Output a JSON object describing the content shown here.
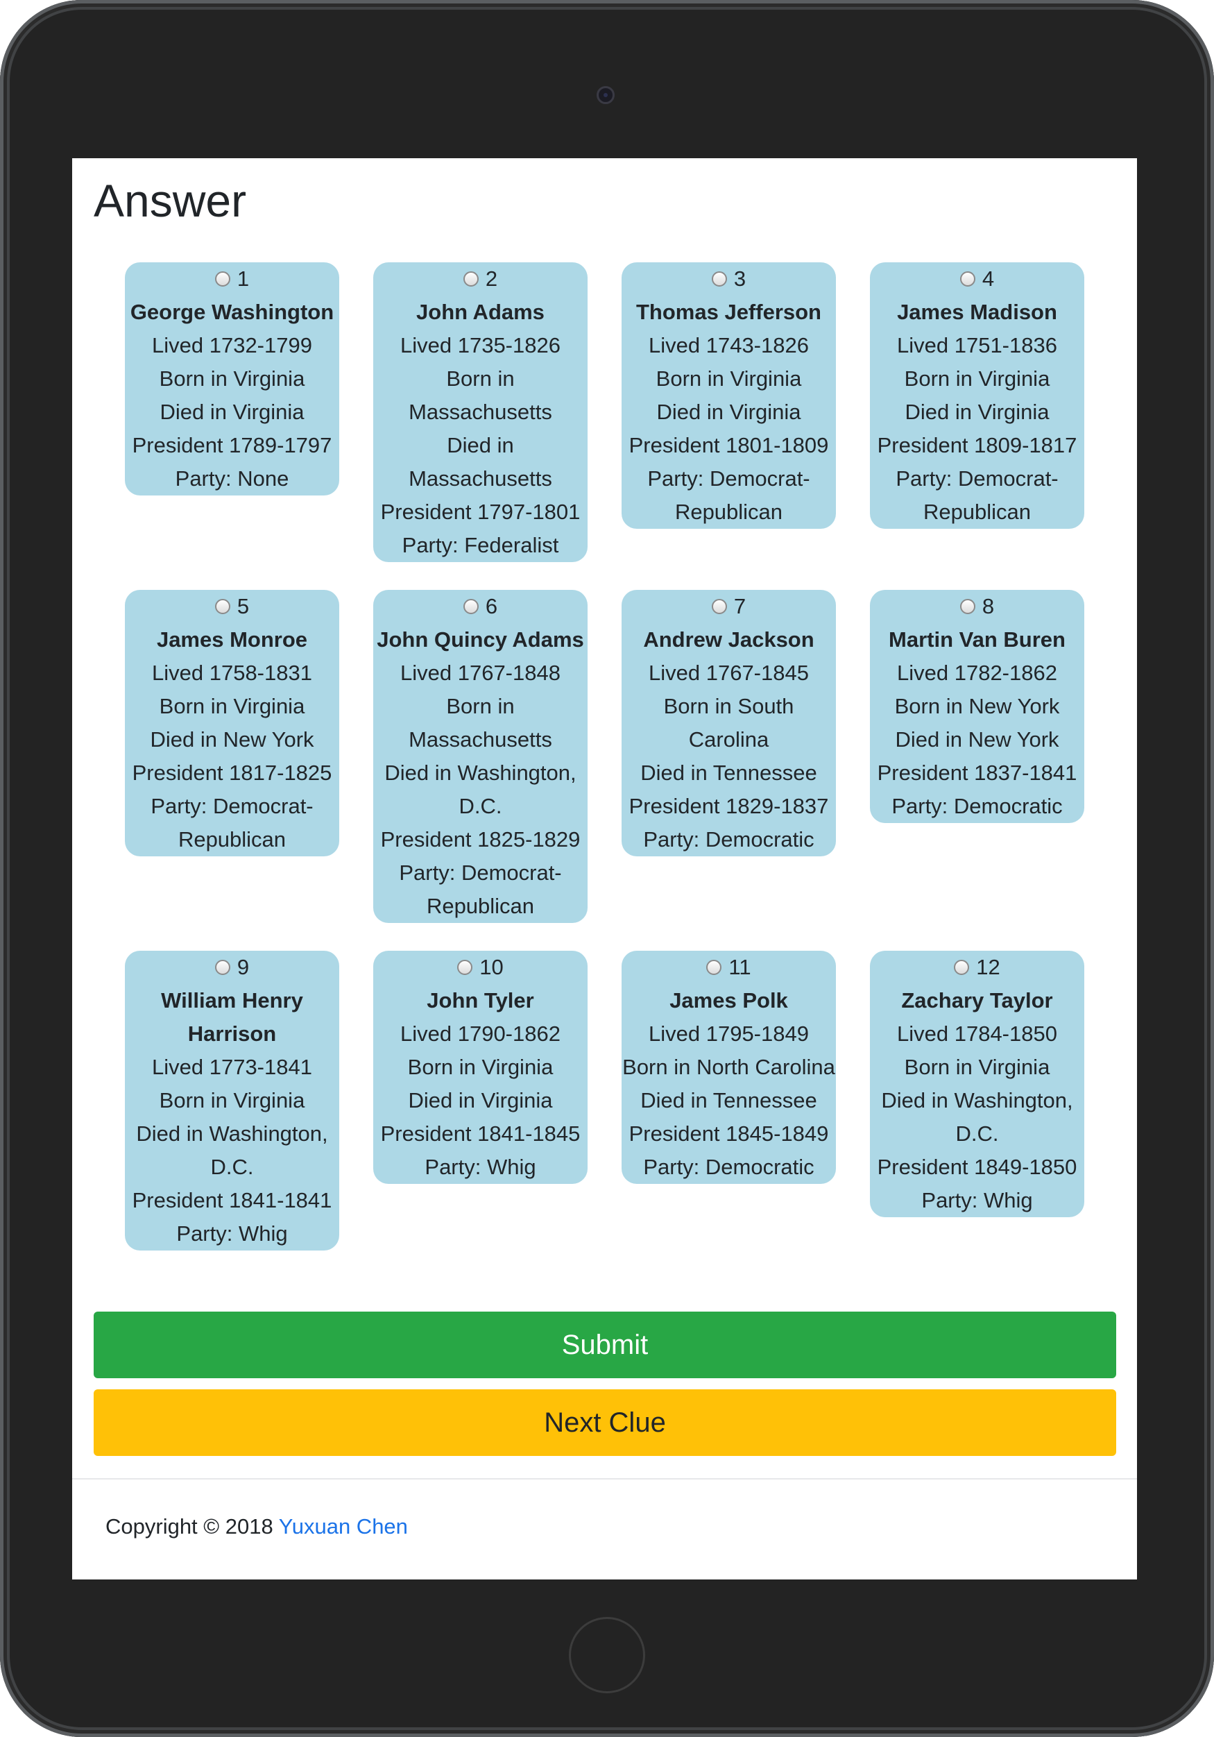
{
  "page": {
    "title": "Answer"
  },
  "presidents": [
    {
      "number": "1",
      "name": "George Washington",
      "lived": "Lived 1732-1799",
      "born": "Born in Virginia",
      "died": "Died in Virginia",
      "president": "President 1789-1797",
      "party": "Party: None"
    },
    {
      "number": "2",
      "name": "John Adams",
      "lived": "Lived 1735-1826",
      "born": "Born in Massachusetts",
      "died": "Died in Massachusetts",
      "president": "President 1797-1801",
      "party": "Party: Federalist"
    },
    {
      "number": "3",
      "name": "Thomas Jefferson",
      "lived": "Lived 1743-1826",
      "born": "Born in Virginia",
      "died": "Died in Virginia",
      "president": "President 1801-1809",
      "party": "Party: Democrat-Republican"
    },
    {
      "number": "4",
      "name": "James Madison",
      "lived": "Lived 1751-1836",
      "born": "Born in Virginia",
      "died": "Died in Virginia",
      "president": "President 1809-1817",
      "party": "Party: Democrat-Republican"
    },
    {
      "number": "5",
      "name": "James Monroe",
      "lived": "Lived 1758-1831",
      "born": "Born in Virginia",
      "died": "Died in New York",
      "president": "President 1817-1825",
      "party": "Party: Democrat-Republican"
    },
    {
      "number": "6",
      "name": "John Quincy Adams",
      "lived": "Lived 1767-1848",
      "born": "Born in Massachusetts",
      "died": "Died in Washington, D.C.",
      "president": "President 1825-1829",
      "party": "Party: Democrat-Republican"
    },
    {
      "number": "7",
      "name": "Andrew Jackson",
      "lived": "Lived 1767-1845",
      "born": "Born in South Carolina",
      "died": "Died in Tennessee",
      "president": "President 1829-1837",
      "party": "Party: Democratic"
    },
    {
      "number": "8",
      "name": "Martin Van Buren",
      "lived": "Lived 1782-1862",
      "born": "Born in New York",
      "died": "Died in New York",
      "president": "President 1837-1841",
      "party": "Party: Democratic"
    },
    {
      "number": "9",
      "name": "William Henry Harrison",
      "lived": "Lived 1773-1841",
      "born": "Born in Virginia",
      "died": "Died in Washington, D.C.",
      "president": "President 1841-1841",
      "party": "Party: Whig"
    },
    {
      "number": "10",
      "name": "John Tyler",
      "lived": "Lived 1790-1862",
      "born": "Born in Virginia",
      "died": "Died in Virginia",
      "president": "President 1841-1845",
      "party": "Party: Whig"
    },
    {
      "number": "11",
      "name": "James Polk",
      "lived": "Lived 1795-1849",
      "born": "Born in North Carolina",
      "died": "Died in Tennessee",
      "president": "President 1845-1849",
      "party": "Party: Democratic"
    },
    {
      "number": "12",
      "name": "Zachary Taylor",
      "lived": "Lived 1784-1850",
      "born": "Born in Virginia",
      "died": "Died in Washington, D.C.",
      "president": "President 1849-1850",
      "party": "Party: Whig"
    }
  ],
  "buttons": {
    "submit_label": "Submit",
    "next_clue_label": "Next Clue"
  },
  "footer": {
    "copyright": "Copyright © 2018",
    "author": "Yuxuan Chen"
  },
  "colors": {
    "card_bg": "#add8e6",
    "submit": "#28a745",
    "next_clue": "#ffc107",
    "link": "#1b73e8"
  }
}
